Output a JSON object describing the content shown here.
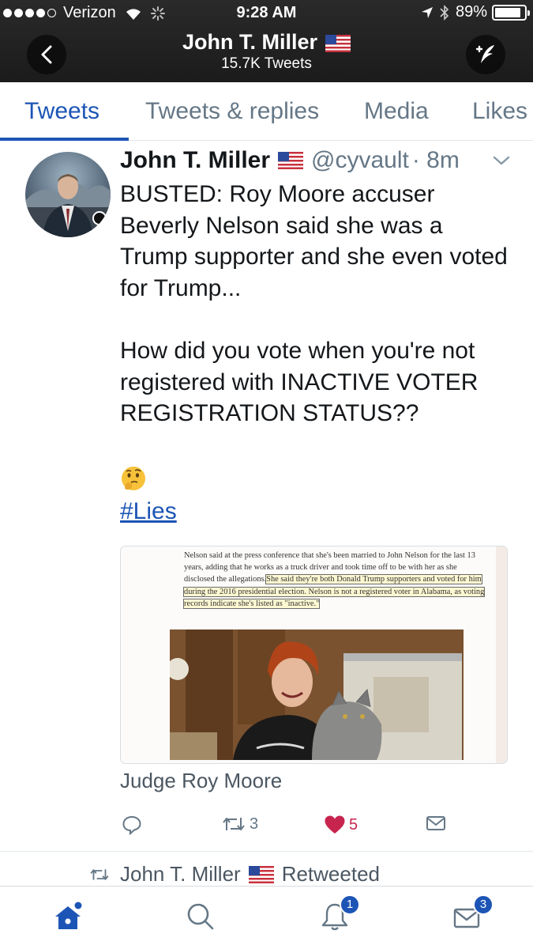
{
  "status_bar": {
    "carrier": "Verizon",
    "time": "9:28 AM",
    "battery": "89%",
    "battery_level": 0.89
  },
  "header": {
    "name": "John T. Miller",
    "tweet_count": "15.7K Tweets"
  },
  "tabs": [
    {
      "label": "Tweets",
      "active": true
    },
    {
      "label": "Tweets & replies",
      "active": false
    },
    {
      "label": "Media",
      "active": false
    },
    {
      "label": "Likes",
      "active": false
    }
  ],
  "tweet": {
    "author": "John T. Miller",
    "handle": "@cyvault",
    "time": "· 8m",
    "text": "BUSTED: Roy Moore accuser Beverly Nelson said she was a Trump supporter and she even voted for Trump...\n\nHow did you vote when you're not registered with INACTIVE VOTER REGISTRATION STATUS??",
    "emoji": "thinking-face",
    "hashtag": "#Lies",
    "media": {
      "article_plain": "Nelson said at the press conference that she's been married to John Nelson for the last 13 years, adding that he works as a truck driver and took time off to be with her as she disclosed the allegations.",
      "article_highlight": "She said they're both Donald Trump supporters and voted for him during the 2016 presidential election. Nelson is not a registered voter in Alabama, as voting records indicate she's listed as \"inactive.\""
    },
    "caption": "Judge Roy Moore",
    "retweets": "3",
    "likes": "5",
    "liked": true
  },
  "next_item": {
    "name": "John T. Miller",
    "label": "Retweeted"
  },
  "bottom_nav": {
    "notifications_badge": "1",
    "messages_badge": "3"
  },
  "colors": {
    "accent": "#1c55b5",
    "like": "#c7254e",
    "muted": "#657786"
  }
}
